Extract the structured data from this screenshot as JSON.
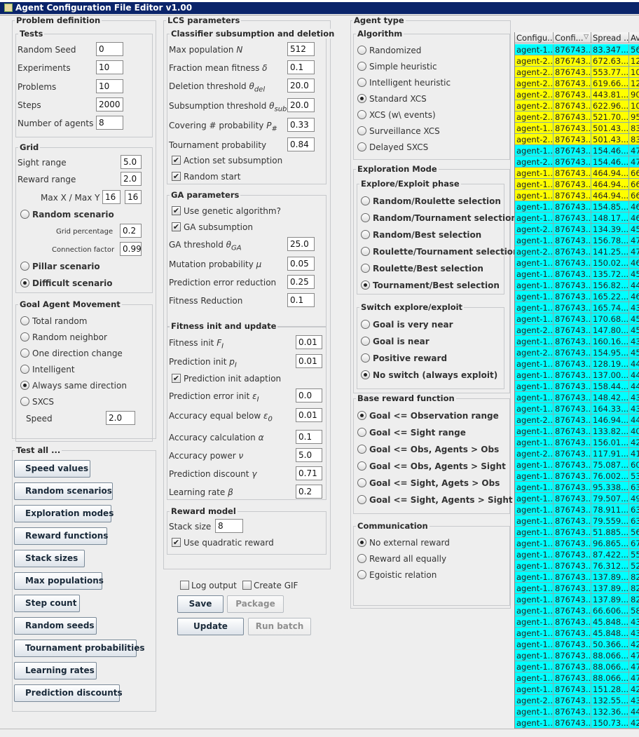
{
  "window": {
    "title": "Agent Configuration File Editor v1.00"
  },
  "problem_definition": {
    "title": "Problem definition",
    "tests": {
      "title": "Tests",
      "fields": [
        {
          "label": "Random Seed",
          "value": "0"
        },
        {
          "label": "Experiments",
          "value": "10"
        },
        {
          "label": "Problems",
          "value": "10"
        },
        {
          "label": "Steps",
          "value": "2000"
        },
        {
          "label": "Number of agents",
          "value": "8"
        }
      ]
    },
    "grid": {
      "title": "Grid",
      "sight_range": {
        "label": "Sight range",
        "value": "5.0"
      },
      "reward_range": {
        "label": "Reward range",
        "value": "2.0"
      },
      "max_xy": {
        "label": "Max X / Max Y",
        "x": "16",
        "y": "16"
      },
      "random_scenario": "Random scenario",
      "grid_percentage": {
        "label": "Grid percentage",
        "value": "0.2"
      },
      "connection_factor": {
        "label": "Connection factor",
        "value": "0.99"
      },
      "pillar_scenario": "Pillar scenario",
      "difficult_scenario": "Difficult scenario"
    },
    "goal_movement": {
      "title": "Goal Agent Movement",
      "options": [
        "Total random",
        "Random neighbor",
        "One direction change",
        "Intelligent",
        "Always same direction",
        "SXCS"
      ],
      "selected": 4,
      "speed": {
        "label": "Speed",
        "value": "2.0"
      }
    }
  },
  "test_all": {
    "title": "Test all ...",
    "buttons": [
      "Speed values",
      "Random scenarios",
      "Exploration modes",
      "Reward functions",
      "Stack sizes",
      "Max populations",
      "Step count",
      "Random seeds",
      "Tournament probabilities",
      "Learning rates",
      "Prediction discounts"
    ]
  },
  "lcs": {
    "title": "LCS parameters",
    "subsumption": {
      "title": "Classifier subsumption and deletion",
      "max_population": {
        "label": "Max population",
        "sym": "N",
        "value": "512"
      },
      "fraction_mean": {
        "label": "Fraction mean fitness",
        "sym": "δ",
        "value": "0.1"
      },
      "deletion_threshold": {
        "label": "Deletion threshold",
        "sym": "θ",
        "sub": "del",
        "value": "20.0"
      },
      "subsumption_threshold": {
        "label": "Subsumption threshold",
        "sym": "θ",
        "sub": "sub",
        "value": "20.0"
      },
      "covering": {
        "label": "Covering # probability",
        "sym": "P",
        "sub": "#",
        "value": "0.33"
      },
      "tournament": {
        "label": "Tournament probability",
        "value": "0.84"
      },
      "action_set": "Action set subsumption",
      "random_start": "Random start"
    },
    "ga": {
      "title": "GA parameters",
      "use_ga": "Use genetic algorithm?",
      "ga_subsumption": "GA subsumption",
      "ga_threshold": {
        "label": "GA threshold",
        "sym": "θ",
        "sub": "GA",
        "value": "25.0"
      },
      "mutation": {
        "label": "Mutation probability",
        "sym": "μ",
        "value": "0.05"
      },
      "pred_error_red": {
        "label": "Prediction error reduction",
        "value": "0.25"
      },
      "fitness_red": {
        "label": "Fitness Reduction",
        "value": "0.1"
      }
    },
    "fitness": {
      "title": "Fitness init and update",
      "fitness_init": {
        "label": "Fitness init",
        "sym": "F",
        "sub": "I",
        "value": "0.01"
      },
      "prediction_init": {
        "label": "Prediction init",
        "sym": "p",
        "sub": "I",
        "value": "0.01"
      },
      "pred_adaption": "Prediction init adaption",
      "pred_error_init": {
        "label": "Prediction error init",
        "sym": "ε",
        "sub": "I",
        "value": "0.0"
      },
      "accuracy_equal": {
        "label": "Accuracy equal below",
        "sym": "ε",
        "sub": "0",
        "value": "0.01"
      },
      "accuracy_calc": {
        "label": "Accuracy calculation",
        "sym": "α",
        "value": "0.1"
      },
      "accuracy_power": {
        "label": "Accuracy power",
        "sym": "ν",
        "value": "5.0"
      },
      "pred_discount": {
        "label": "Prediction discount",
        "sym": "γ",
        "value": "0.71"
      },
      "learning_rate": {
        "label": "Learning rate",
        "sym": "β",
        "value": "0.2"
      }
    },
    "reward_model": {
      "title": "Reward model",
      "stack_size": {
        "label": "Stack size",
        "value": "8"
      },
      "quadratic": "Use quadratic reward"
    }
  },
  "actions": {
    "log_output": "Log output",
    "create_gif": "Create GIF",
    "save": "Save",
    "package": "Package",
    "update": "Update",
    "run_batch": "Run batch"
  },
  "agent_type": {
    "title": "Agent type",
    "algorithm": {
      "title": "Algorithm",
      "options": [
        "Randomized",
        "Simple heuristic",
        "Intelligent heuristic",
        "Standard XCS",
        "XCS (w\\ events)",
        "Surveillance XCS",
        "Delayed SXCS"
      ],
      "selected": 3
    },
    "exploration": {
      "title": "Exploration Mode",
      "phase": {
        "title": "Explore/Exploit phase",
        "options": [
          "Random/Roulette selection",
          "Random/Tournament selection",
          "Random/Best selection",
          "Roulette/Tournament selection",
          "Roulette/Best selection",
          "Tournament/Best selection"
        ],
        "selected": 5
      },
      "switch": {
        "title": "Switch explore/exploit",
        "options": [
          "Goal is very near",
          "Goal is near",
          "Positive reward",
          "No switch (always exploit)"
        ],
        "selected": 3
      }
    },
    "reward_fn": {
      "title": "Base reward function",
      "options": [
        "Goal <= Observation range",
        "Goal <= Sight range",
        "Goal <= Obs, Agents > Obs",
        "Goal <= Obs, Agents > Sight",
        "Goal <= Sight, Agets > Obs",
        "Goal <= Sight, Agents > Sight"
      ],
      "selected": 0
    },
    "communication": {
      "title": "Communication",
      "options": [
        "No external reward",
        "Reward all equally",
        "Egoistic relation"
      ],
      "selected": 0
    }
  },
  "results_table": {
    "headers": [
      "Configu...",
      "Confi...",
      "Spread ...",
      "Av"
    ],
    "cyan": "#00ffff",
    "yellow": "#ffff00",
    "rows": [
      [
        "agent-1...",
        "876743...",
        "83.347...",
        "56",
        "c"
      ],
      [
        "agent-2...",
        "876743...",
        "672.63...",
        "12",
        "y"
      ],
      [
        "agent-2...",
        "876743...",
        "553.77...",
        "10",
        "y"
      ],
      [
        "agent-2...",
        "876743...",
        "619.66...",
        "12",
        "y"
      ],
      [
        "agent-2...",
        "876743...",
        "443.81...",
        "90",
        "y"
      ],
      [
        "agent-2...",
        "876743...",
        "622.96...",
        "10",
        "y"
      ],
      [
        "agent-2...",
        "876743...",
        "521.70...",
        "95",
        "y"
      ],
      [
        "agent-1...",
        "876743...",
        "501.43...",
        "83",
        "y"
      ],
      [
        "agent-2...",
        "876743...",
        "501.43...",
        "83",
        "y"
      ],
      [
        "agent-1...",
        "876743...",
        "154.46...",
        "47",
        "c"
      ],
      [
        "agent-2...",
        "876743...",
        "154.46...",
        "47",
        "c"
      ],
      [
        "agent-1...",
        "876743...",
        "464.94...",
        "66",
        "y"
      ],
      [
        "agent-1...",
        "876743...",
        "464.94...",
        "66",
        "y"
      ],
      [
        "agent-1...",
        "876743...",
        "464.94...",
        "66",
        "y"
      ],
      [
        "agent-1...",
        "876743...",
        "154.85...",
        "46",
        "c"
      ],
      [
        "agent-1...",
        "876743...",
        "148.17...",
        "46",
        "c"
      ],
      [
        "agent-2...",
        "876743...",
        "134.39...",
        "45",
        "c"
      ],
      [
        "agent-1...",
        "876743...",
        "156.78...",
        "47",
        "c"
      ],
      [
        "agent-2...",
        "876743...",
        "141.25...",
        "47",
        "c"
      ],
      [
        "agent-1...",
        "876743...",
        "150.02...",
        "46",
        "c"
      ],
      [
        "agent-1...",
        "876743...",
        "135.72...",
        "45",
        "c"
      ],
      [
        "agent-1...",
        "876743...",
        "156.82...",
        "44",
        "c"
      ],
      [
        "agent-1...",
        "876743...",
        "165.22...",
        "46",
        "c"
      ],
      [
        "agent-1...",
        "876743...",
        "165.74...",
        "43",
        "c"
      ],
      [
        "agent-1...",
        "876743...",
        "170.68...",
        "45",
        "c"
      ],
      [
        "agent-2...",
        "876743...",
        "147.80...",
        "45",
        "c"
      ],
      [
        "agent-1...",
        "876743...",
        "160.16...",
        "43",
        "c"
      ],
      [
        "agent-2...",
        "876743...",
        "154.95...",
        "45",
        "c"
      ],
      [
        "agent-1...",
        "876743...",
        "128.19...",
        "44",
        "c"
      ],
      [
        "agent-1...",
        "876743...",
        "137.00...",
        "44",
        "c"
      ],
      [
        "agent-1...",
        "876743...",
        "158.44...",
        "44",
        "c"
      ],
      [
        "agent-1...",
        "876743...",
        "148.42...",
        "43",
        "c"
      ],
      [
        "agent-1...",
        "876743...",
        "164.33...",
        "43",
        "c"
      ],
      [
        "agent-2...",
        "876743...",
        "146.94...",
        "44",
        "c"
      ],
      [
        "agent-1...",
        "876743...",
        "133.82...",
        "40",
        "c"
      ],
      [
        "agent-1...",
        "876743...",
        "156.01...",
        "42",
        "c"
      ],
      [
        "agent-2...",
        "876743...",
        "117.91...",
        "41",
        "c"
      ],
      [
        "agent-1...",
        "876743...",
        "75.087...",
        "60",
        "c"
      ],
      [
        "agent-1...",
        "876743...",
        "76.002...",
        "53",
        "c"
      ],
      [
        "agent-1...",
        "876743...",
        "95.338...",
        "63",
        "c"
      ],
      [
        "agent-1...",
        "876743...",
        "79.507...",
        "49",
        "c"
      ],
      [
        "agent-1...",
        "876743...",
        "78.911...",
        "63",
        "c"
      ],
      [
        "agent-1...",
        "876743...",
        "79.559...",
        "63",
        "c"
      ],
      [
        "agent-1...",
        "876743...",
        "51.885...",
        "56",
        "c"
      ],
      [
        "agent-1...",
        "876743...",
        "96.865...",
        "67",
        "c"
      ],
      [
        "agent-1...",
        "876743...",
        "87.422...",
        "55",
        "c"
      ],
      [
        "agent-1...",
        "876743...",
        "76.312...",
        "52",
        "c"
      ],
      [
        "agent-1...",
        "876743...",
        "137.89...",
        "82",
        "c"
      ],
      [
        "agent-1...",
        "876743...",
        "137.89...",
        "82",
        "c"
      ],
      [
        "agent-1...",
        "876743...",
        "137.89...",
        "82",
        "c"
      ],
      [
        "agent-1...",
        "876743...",
        "66.606...",
        "58",
        "c"
      ],
      [
        "agent-1...",
        "876743...",
        "45.848...",
        "43",
        "c"
      ],
      [
        "agent-1...",
        "876743...",
        "45.848...",
        "43",
        "c"
      ],
      [
        "agent-1...",
        "876743...",
        "50.366...",
        "42",
        "c"
      ],
      [
        "agent-1...",
        "876743...",
        "88.066...",
        "47",
        "c"
      ],
      [
        "agent-1...",
        "876743...",
        "88.066...",
        "47",
        "c"
      ],
      [
        "agent-1...",
        "876743...",
        "88.066...",
        "47",
        "c"
      ],
      [
        "agent-1...",
        "876743...",
        "151.28...",
        "42",
        "c"
      ],
      [
        "agent-2...",
        "876743...",
        "132.55...",
        "43",
        "c"
      ],
      [
        "agent-1...",
        "876743...",
        "132.36...",
        "44",
        "c"
      ],
      [
        "agent-1...",
        "876743...",
        "150.73...",
        "42",
        "c"
      ]
    ]
  }
}
